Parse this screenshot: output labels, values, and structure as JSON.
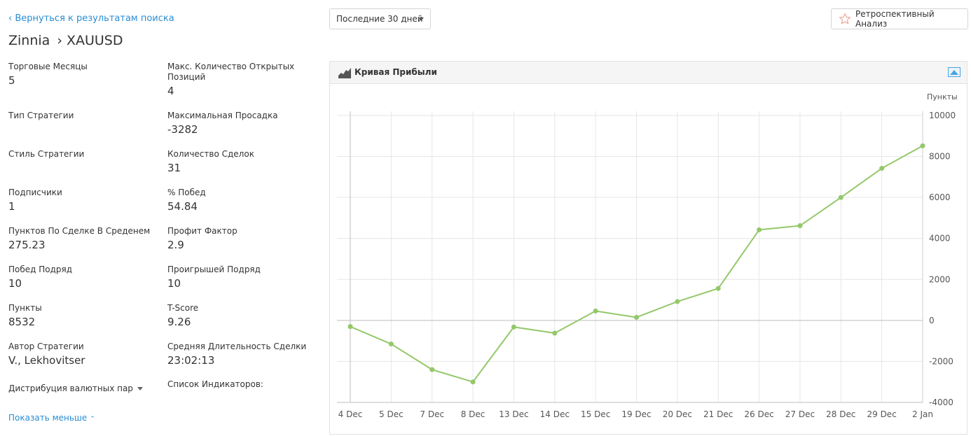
{
  "nav": {
    "back_label": "‹ Вернуться к результатам поиска"
  },
  "header": {
    "strategy_name": "Zinnia",
    "symbol": "› XAUUSD"
  },
  "toolbar": {
    "period_label": "Последние 30 дней",
    "retro_label": "Ретроспективный Анализ"
  },
  "stats_left": [
    {
      "label": "Торговые Месяцы",
      "value": "5"
    },
    {
      "label": "Тип Стратегии",
      "value": ""
    },
    {
      "label": "Стиль Стратегии",
      "value": ""
    },
    {
      "label": "Подписчики",
      "value": "1"
    },
    {
      "label": "Пунктов По Сделке В Среденем",
      "value": "275.23"
    },
    {
      "label": "Побед Подряд",
      "value": "10"
    },
    {
      "label": "Пункты",
      "value": "8532"
    },
    {
      "label": "Автор Стратегии",
      "value": "V., Lekhovitser"
    }
  ],
  "stats_right": [
    {
      "label": "Макс. Количество Открытых Позиций",
      "value": "4"
    },
    {
      "label": "Максимальная Просадка",
      "value": "-3282"
    },
    {
      "label": "Количество Сделок",
      "value": "31"
    },
    {
      "label": "% Побед",
      "value": "54.84"
    },
    {
      "label": "Профит Фактор",
      "value": "2.9"
    },
    {
      "label": "Проигрышей Подряд",
      "value": "10"
    },
    {
      "label": "T-Score",
      "value": "9.26"
    },
    {
      "label": "Средняя Длительность Сделки",
      "value": "23:02:13"
    }
  ],
  "footer": {
    "distribution_label": "Дистрибуция валютных пар",
    "indicators_label": "Список Индикаторов:",
    "show_less_label": "Показать меньше"
  },
  "chart_panel": {
    "title": "Кривая Прибыли"
  },
  "icons": {
    "back": "chevron-left-icon",
    "period": "caret-down-icon",
    "retro": "star-outline-icon",
    "chart_type": "area-chart-icon",
    "export": "image-icon",
    "distribution": "caret-down-icon",
    "show_less": "chevron-up-icon"
  },
  "colors": {
    "link": "#2a8dd4",
    "series": "#94c86a",
    "retro_star": "#f0a090",
    "grid": "#e6e6e6"
  },
  "chart_data": {
    "type": "line",
    "title": "",
    "xlabel": "",
    "ylabel": "Пункты",
    "ylim": [
      -4000,
      10000
    ],
    "yticks": [
      10000,
      8000,
      6000,
      4000,
      2000,
      0,
      -2000,
      -4000
    ],
    "grid": true,
    "legend": "none",
    "y_axis_side": "right",
    "categories": [
      "4 Dec",
      "5 Dec",
      "7 Dec",
      "8 Dec",
      "13 Dec",
      "14 Dec",
      "15 Dec",
      "19 Dec",
      "20 Dec",
      "21 Dec",
      "26 Dec",
      "27 Dec",
      "28 Dec",
      "29 Dec",
      "2 Jan"
    ],
    "series": [
      {
        "values": [
          -300,
          -1150,
          -2400,
          -3000,
          -320,
          -620,
          460,
          150,
          920,
          1560,
          4420,
          4620,
          6000,
          7420,
          8520
        ]
      }
    ]
  }
}
